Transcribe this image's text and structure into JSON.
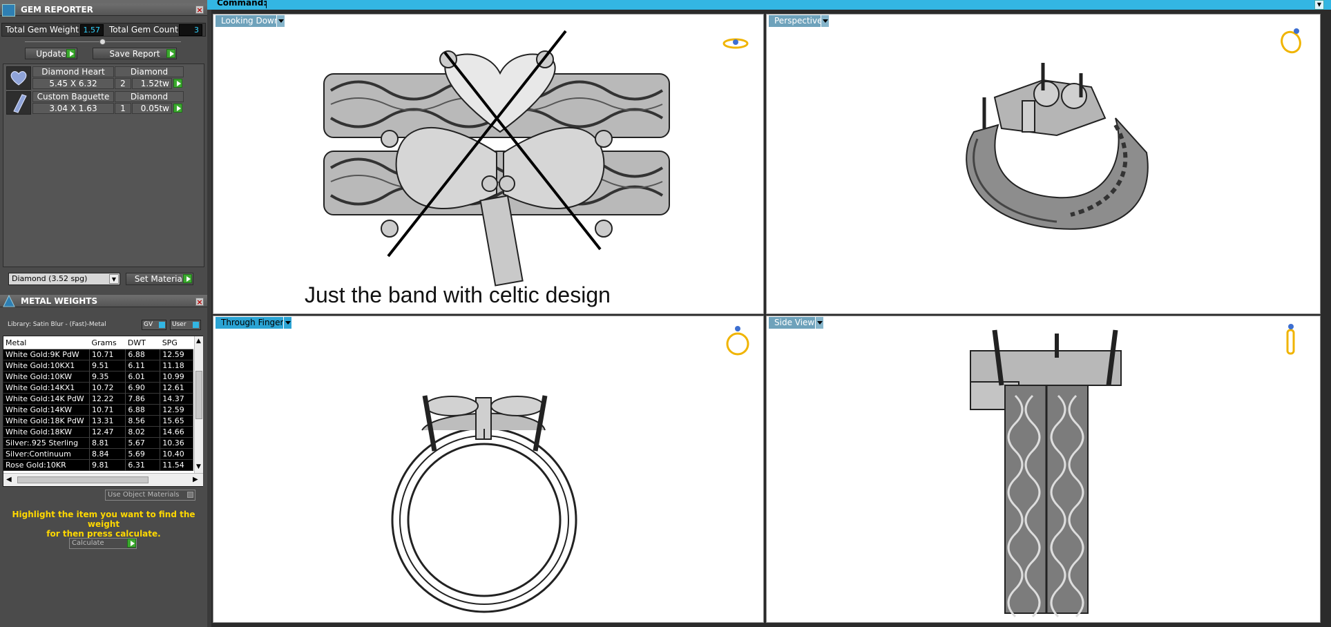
{
  "command": {
    "label": "Command:"
  },
  "gem_reporter": {
    "title": "GEM REPORTER",
    "total_weight_label": "Total Gem Weight",
    "total_weight": "1.57",
    "total_count_label": "Total Gem Count",
    "total_count": "3",
    "update_label": "Update",
    "save_report_label": "Save Report",
    "gems": [
      {
        "name": "Diamond Heart",
        "material": "Diamond",
        "size": "5.45 X 6.32",
        "qty": "2",
        "tw": "1.52tw"
      },
      {
        "name": "Custom Baguette",
        "material": "Diamond",
        "size": "3.04 X 1.63",
        "qty": "1",
        "tw": "0.05tw"
      }
    ],
    "material_select": "Diamond    (3.52 spg)",
    "set_material_label": "Set Material"
  },
  "metal_weights": {
    "title": "METAL WEIGHTS",
    "library": "Library: Satin Blur - (Fast)-Metal",
    "gv_label": "GV",
    "user_label": "User",
    "columns": [
      "Metal",
      "Grams",
      "DWT",
      "SPG"
    ],
    "rows": [
      [
        "White Gold:9K PdW",
        "10.71",
        "6.88",
        "12.59"
      ],
      [
        "White Gold:10KX1",
        "9.51",
        "6.11",
        "11.18"
      ],
      [
        "White Gold:10KW",
        "9.35",
        "6.01",
        "10.99"
      ],
      [
        "White Gold:14KX1",
        "10.72",
        "6.90",
        "12.61"
      ],
      [
        "White Gold:14K PdW",
        "12.22",
        "7.86",
        "14.37"
      ],
      [
        "White Gold:14KW",
        "10.71",
        "6.88",
        "12.59"
      ],
      [
        "White Gold:18K PdW",
        "13.31",
        "8.56",
        "15.65"
      ],
      [
        "White Gold:18KW",
        "12.47",
        "8.02",
        "14.66"
      ],
      [
        "Silver:.925 Sterling",
        "8.81",
        "5.67",
        "10.36"
      ],
      [
        "Silver:Continuum",
        "8.84",
        "5.69",
        "10.40"
      ],
      [
        "Rose Gold:10KR",
        "9.81",
        "6.31",
        "11.54"
      ]
    ],
    "use_object_materials_label": "Use Object Materials",
    "hint_line1": "Highlight the item you want to find the weight",
    "hint_line2": "for then press calculate.",
    "calculate_label": "Calculate"
  },
  "viewports": {
    "looking_down": "Looking Down",
    "perspective": "Perspective",
    "through_finger": "Through Finger",
    "side_view": "Side View"
  },
  "annotation": "Just the band with celtic design",
  "colors": {
    "accent": "#33b6e3",
    "panel": "#4b4b4b",
    "value": "#32d4ff",
    "hint": "#ffd800",
    "go": "#3caa2f"
  }
}
